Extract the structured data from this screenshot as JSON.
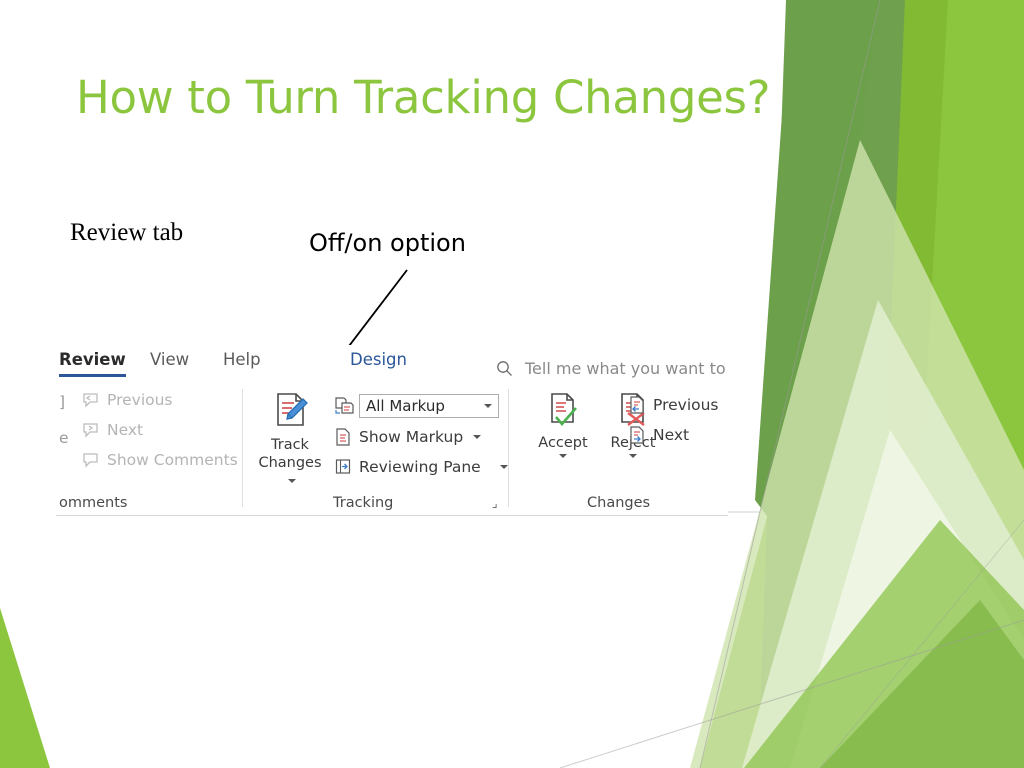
{
  "slide": {
    "title": "How to Turn Tracking Changes?",
    "title_color": "#8CC63E",
    "background_color": "#FFFFFF"
  },
  "annotations": [
    {
      "id": "review-tab",
      "text": "Review tab"
    },
    {
      "id": "off-on",
      "text": "Off/on option"
    }
  ],
  "ribbon": {
    "tabs": [
      {
        "label": "Review",
        "active": true
      },
      {
        "label": "View",
        "active": false
      },
      {
        "label": "Help",
        "active": false
      },
      {
        "label": "Design",
        "active": false
      }
    ],
    "search": {
      "icon": "search-icon",
      "placeholder": "Tell me what you want to"
    },
    "groups": [
      {
        "name": "omments",
        "clipped_left": true,
        "left_fragments": [
          "]",
          "e"
        ],
        "commands": [
          {
            "label": "Previous",
            "icon": "comment-previous-icon",
            "disabled": true
          },
          {
            "label": "Next",
            "icon": "comment-next-icon",
            "disabled": true
          },
          {
            "label": "Show Comments",
            "icon": "show-comments-icon",
            "disabled": true
          }
        ]
      },
      {
        "name": "Tracking",
        "has_dialog_launcher": true,
        "big_button": {
          "label_line1": "Track",
          "label_line2": "Changes",
          "icon": "track-changes-icon",
          "has_dropdown": true
        },
        "commands": [
          {
            "label": "All Markup",
            "type": "combobox",
            "icon": "display-for-review-icon"
          },
          {
            "label": "Show Markup",
            "type": "menu",
            "icon": "show-markup-icon",
            "has_dropdown": true
          },
          {
            "label": "Reviewing Pane",
            "type": "menu",
            "icon": "reviewing-pane-icon",
            "has_dropdown": true
          }
        ]
      },
      {
        "name": "Changes",
        "big_buttons": [
          {
            "label": "Accept",
            "icon": "accept-change-icon",
            "has_dropdown": true
          },
          {
            "label": "Reject",
            "icon": "reject-change-icon",
            "has_dropdown": true
          }
        ],
        "commands": [
          {
            "label": "Previous",
            "icon": "previous-change-icon"
          },
          {
            "label": "Next",
            "icon": "next-change-icon"
          }
        ]
      }
    ]
  },
  "theme": {
    "accent_green": "#8CC63E",
    "mid_green": "#82B933",
    "dark_green": "#6FA04E",
    "pale_green": "#DDEBC4",
    "word_blue": "#2B579A"
  }
}
